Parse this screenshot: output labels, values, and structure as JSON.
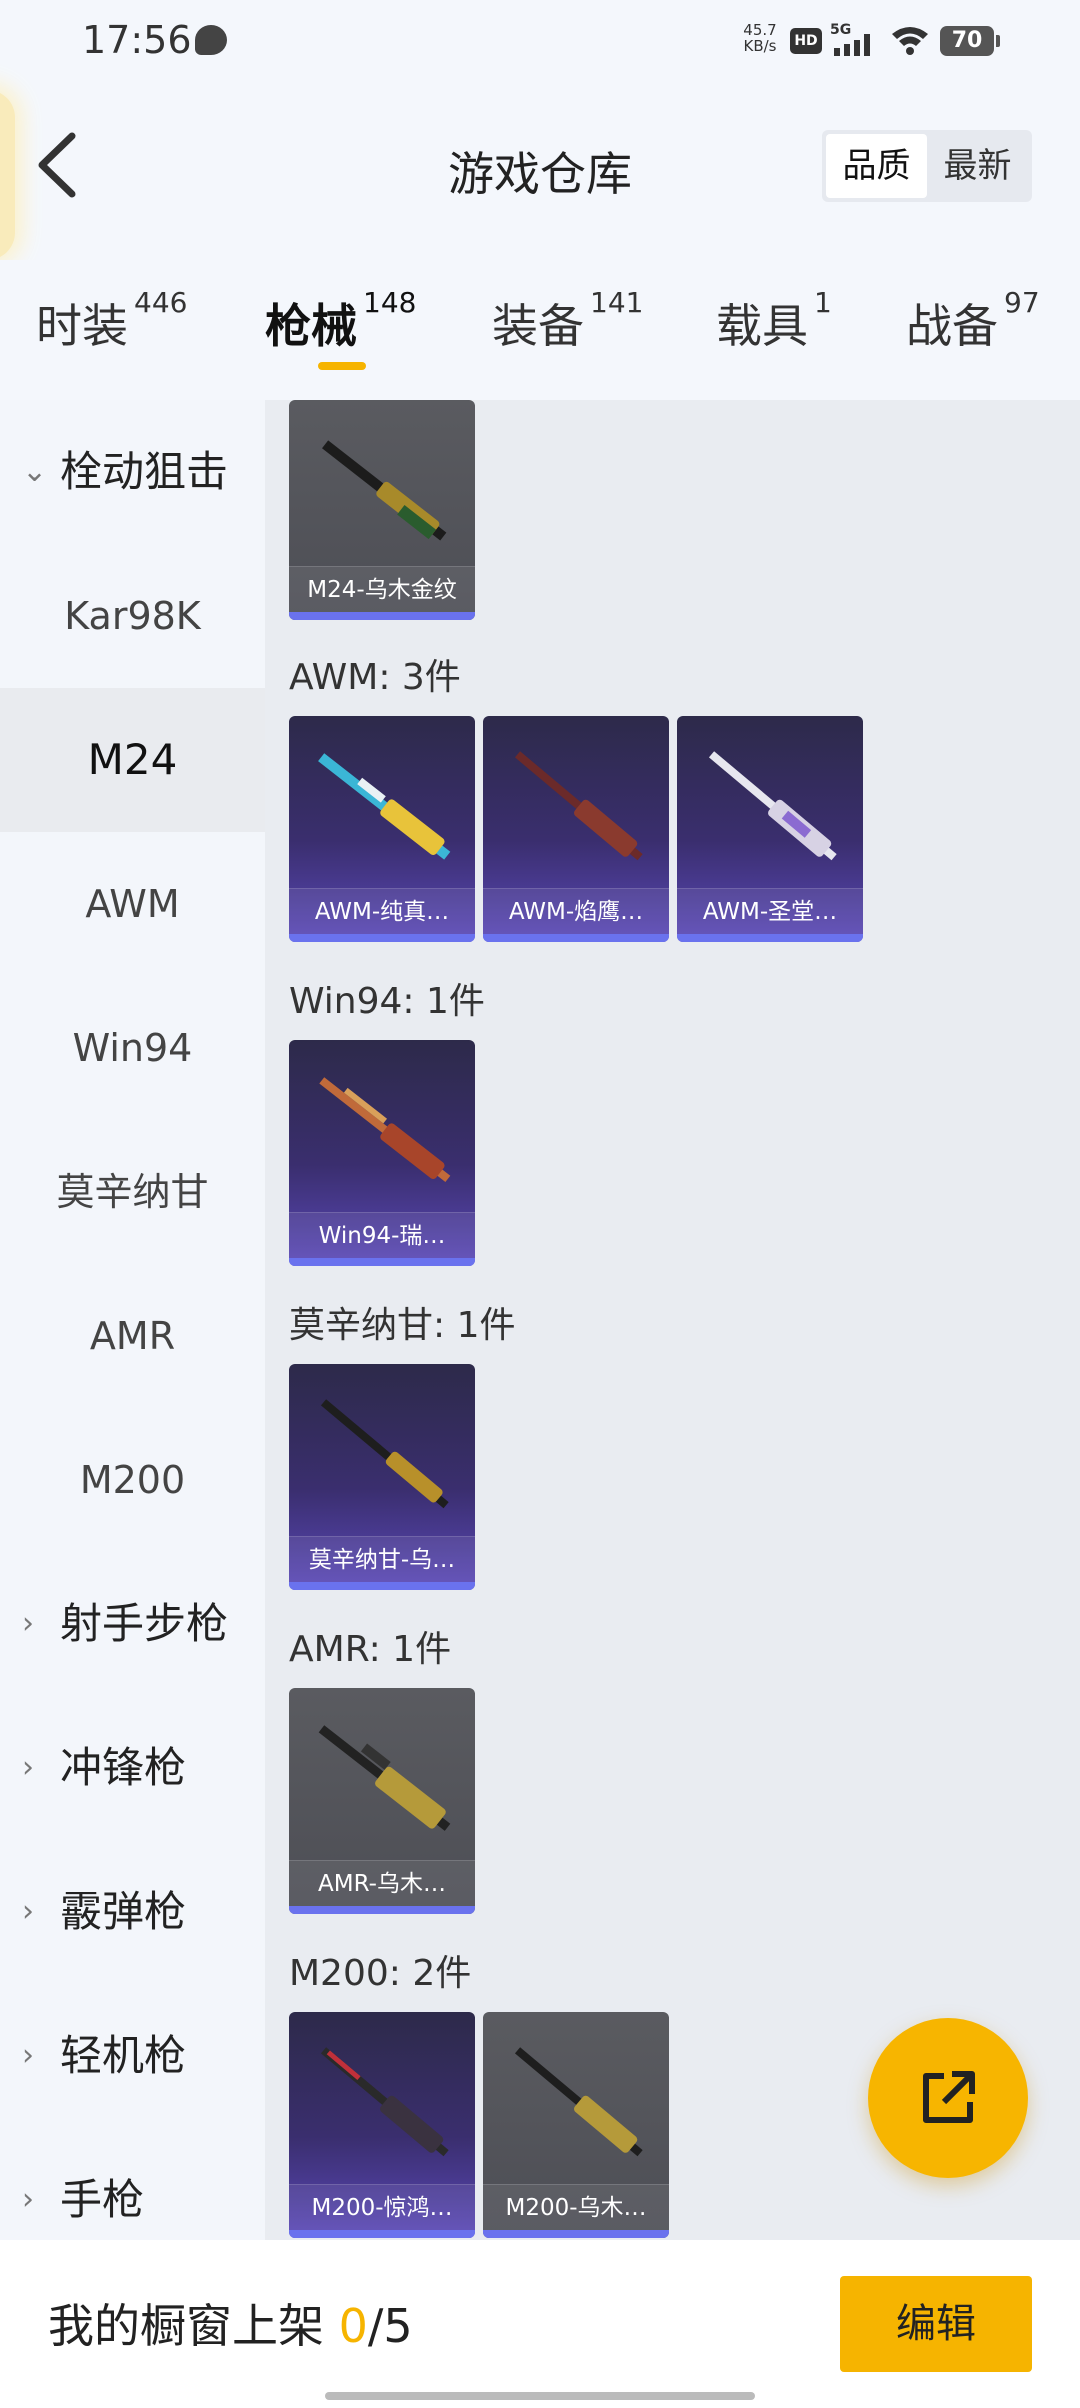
{
  "status": {
    "time": "17:56",
    "speed_value": "45.7",
    "speed_unit": "KB/s",
    "hd": "HD",
    "network": "5G",
    "battery": "70"
  },
  "header": {
    "title": "游戏仓库",
    "sort_quality": "品质",
    "sort_newest": "最新"
  },
  "tabs": [
    {
      "label": "时装",
      "count": "446"
    },
    {
      "label": "枪械",
      "count": "148"
    },
    {
      "label": "装备",
      "count": "141"
    },
    {
      "label": "载具",
      "count": "1"
    },
    {
      "label": "战备",
      "count": "97"
    }
  ],
  "sidebar": {
    "group_open": "栓动狙击",
    "items": [
      "Kar98K",
      "M24",
      "AWM",
      "Win94",
      "莫辛纳甘",
      "AMR",
      "M200"
    ],
    "groups": [
      "射手步枪",
      "冲锋枪",
      "霰弹枪",
      "轻机枪",
      "手枪"
    ]
  },
  "sections": {
    "awm": "AWM: 3件",
    "win94": "Win94: 1件",
    "mosin": "莫辛纳甘: 1件",
    "amr": "AMR: 1件",
    "m200": "M200: 2件"
  },
  "cards": {
    "m24_1": "M24-乌木金纹",
    "awm_1": "AWM-纯真…",
    "awm_2": "AWM-焰鹰…",
    "awm_3": "AWM-圣堂…",
    "win94_1": "Win94-瑞…",
    "mosin_1": "莫辛纳甘-乌…",
    "amr_1": "AMR-乌木…",
    "m200_1": "M200-惊鸿…",
    "m200_2": "M200-乌木…"
  },
  "bottom": {
    "label_prefix": "我的橱窗上架 ",
    "count_current": "0",
    "count_total": "/5",
    "edit": "编辑"
  }
}
